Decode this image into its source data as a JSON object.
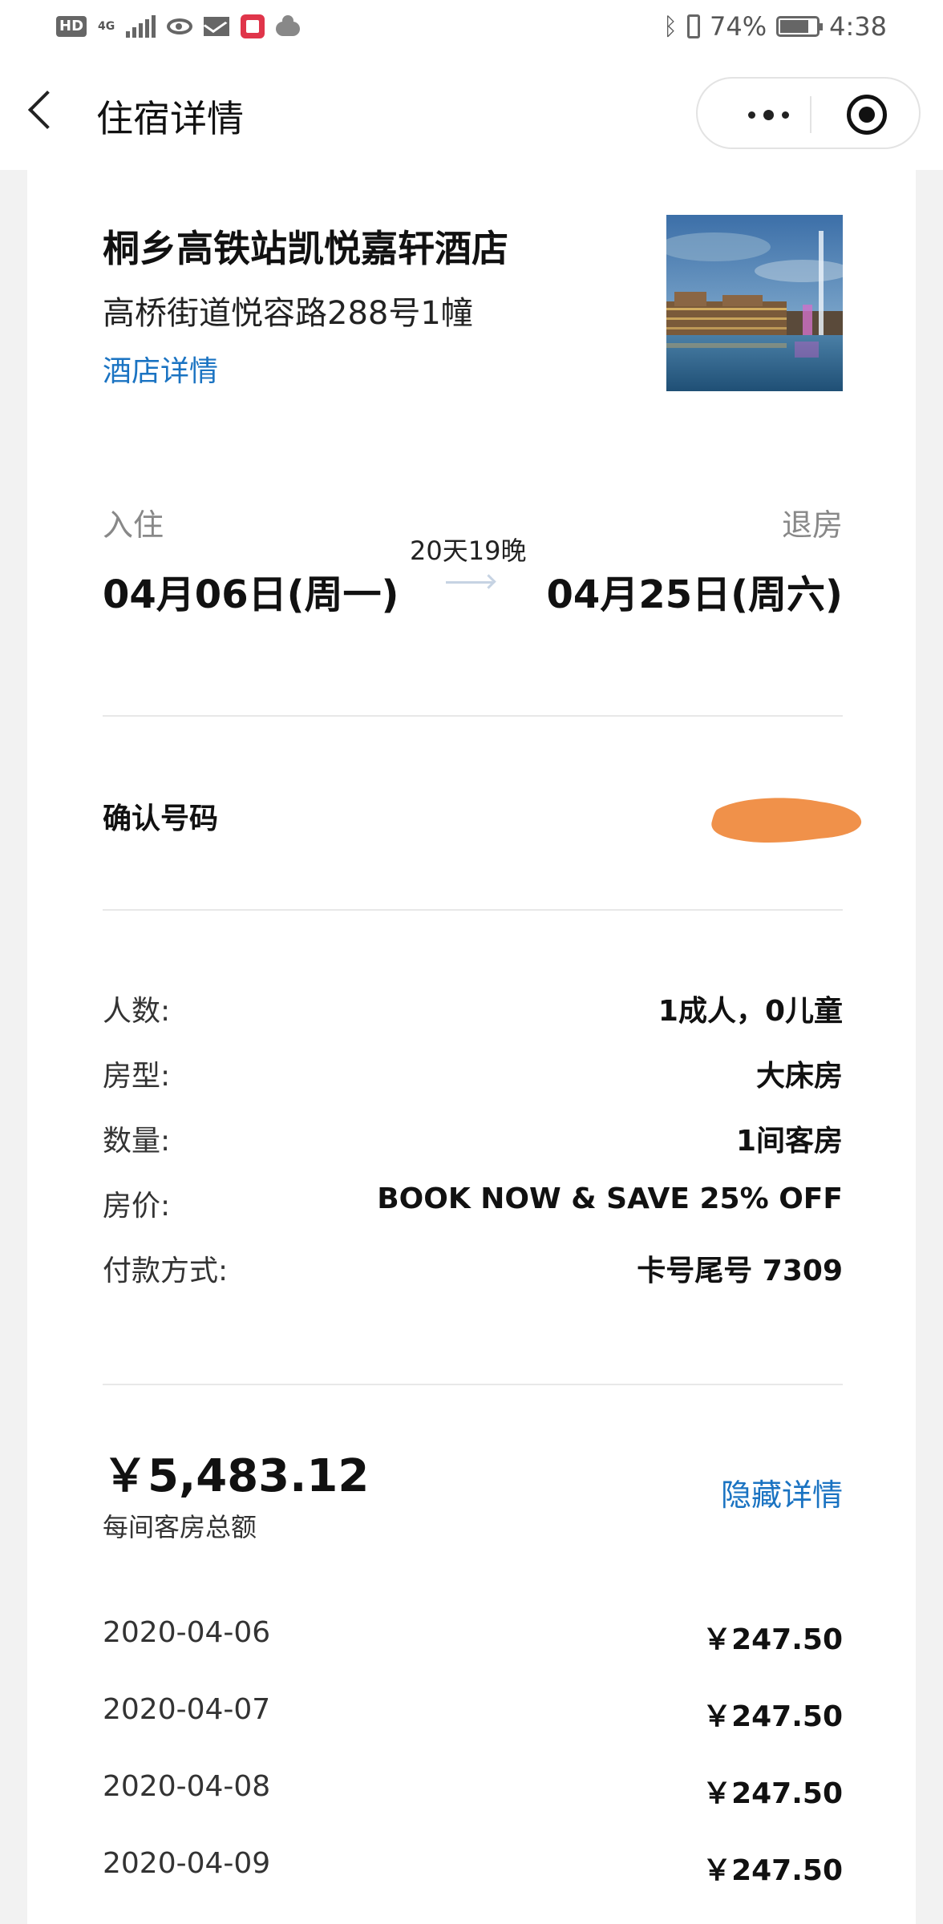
{
  "status_bar": {
    "hd": "HD",
    "network": "4G",
    "battery_pct": "74%",
    "time": "4:38",
    "icons": [
      "hd-icon",
      "signal-icon",
      "eye-icon",
      "mail-icon",
      "app-notification-icon",
      "cloud-icon",
      "bluetooth-icon",
      "vibrate-icon",
      "battery-icon"
    ]
  },
  "nav": {
    "title": "住宿详情",
    "back_icon": "chevron-left-icon",
    "more_icon": "more-dots-icon",
    "close_icon": "target-close-icon"
  },
  "hotel": {
    "name": "桐乡高铁站凯悦嘉轩酒店",
    "address": "高桥街道悦容路288号1幢",
    "details_link": "酒店详情"
  },
  "stay": {
    "checkin_label": "入住",
    "checkout_label": "退房",
    "nights": "20天19晚",
    "checkin_date": "04月06日(周一)",
    "checkout_date": "04月25日(周六)"
  },
  "confirmation": {
    "label": "确认号码"
  },
  "details": [
    {
      "label": "人数:",
      "value": "1成人，0儿童"
    },
    {
      "label": "房型:",
      "value": "大床房"
    },
    {
      "label": "数量:",
      "value": "1间客房"
    },
    {
      "label": "房价:",
      "value": "BOOK NOW & SAVE 25% OFF"
    },
    {
      "label": "付款方式:",
      "value": "卡号尾号 7309"
    }
  ],
  "total": {
    "amount": "￥5,483.12",
    "caption": "每间客房总额",
    "toggle_link": "隐藏详情"
  },
  "daily_rates": [
    {
      "date": "2020-04-06",
      "price": "￥247.50"
    },
    {
      "date": "2020-04-07",
      "price": "￥247.50"
    },
    {
      "date": "2020-04-08",
      "price": "￥247.50"
    },
    {
      "date": "2020-04-09",
      "price": "￥247.50"
    }
  ],
  "colors": {
    "link": "#1a73c2",
    "redaction": "#f0914a",
    "background": "#f2f2f2"
  }
}
